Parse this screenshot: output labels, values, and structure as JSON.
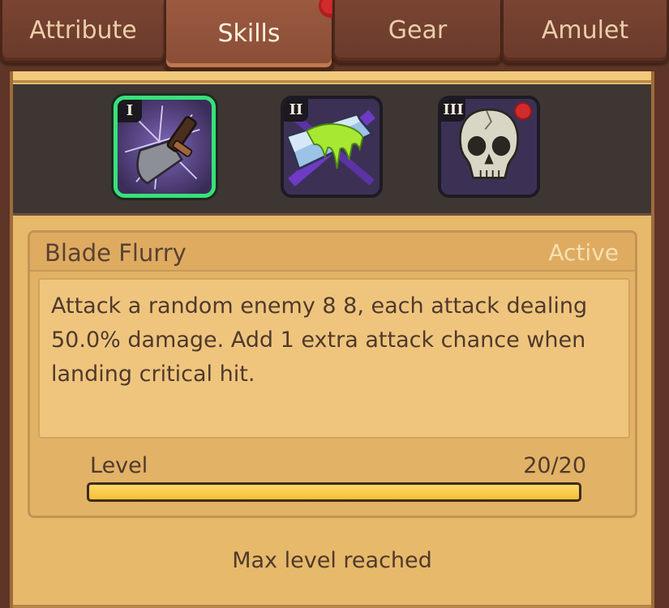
{
  "tabs": [
    {
      "label": "Attribute",
      "active": false,
      "badge": false
    },
    {
      "label": "Skills",
      "active": true,
      "badge": true
    },
    {
      "label": "Gear",
      "active": false,
      "badge": false
    },
    {
      "label": "Amulet",
      "active": false,
      "badge": false
    }
  ],
  "skills": [
    {
      "numeral": "I",
      "icon": "blade-flurry-icon",
      "selected": true,
      "badge": false
    },
    {
      "numeral": "II",
      "icon": "poison-blade-icon",
      "selected": false,
      "badge": false
    },
    {
      "numeral": "III",
      "icon": "skull-icon",
      "selected": false,
      "badge": true
    }
  ],
  "detail": {
    "name": "Blade Flurry",
    "type": "Active",
    "description": "Attack a random enemy 8 8, each attack dealing 50.0% damage. Add 1 extra attack chance when landing critical hit.",
    "level_label": "Level",
    "level_value": "20/20",
    "level_progress": 1.0
  },
  "footer": {
    "status": "Max level reached"
  },
  "colors": {
    "selected_border": "#39e07a",
    "badge_red": "#d22b2b",
    "progress_fill": "#f6bf32",
    "panel_bg": "#e7b96b"
  }
}
